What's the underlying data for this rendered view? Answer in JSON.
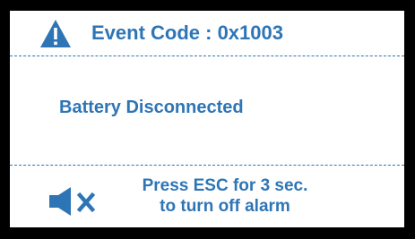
{
  "header": {
    "event_code_text": "Event Code :  0x1003"
  },
  "message": {
    "text": "Battery Disconnected"
  },
  "footer": {
    "hint_line_1": "Press ESC for 3 sec.",
    "hint_line_2": "to turn off alarm"
  },
  "icons": {
    "header_icon": "warning-icon",
    "footer_icon": "mute-speaker-icon"
  },
  "colors": {
    "accent": "#2e75b6",
    "frame": "#000000",
    "background": "#ffffff"
  }
}
